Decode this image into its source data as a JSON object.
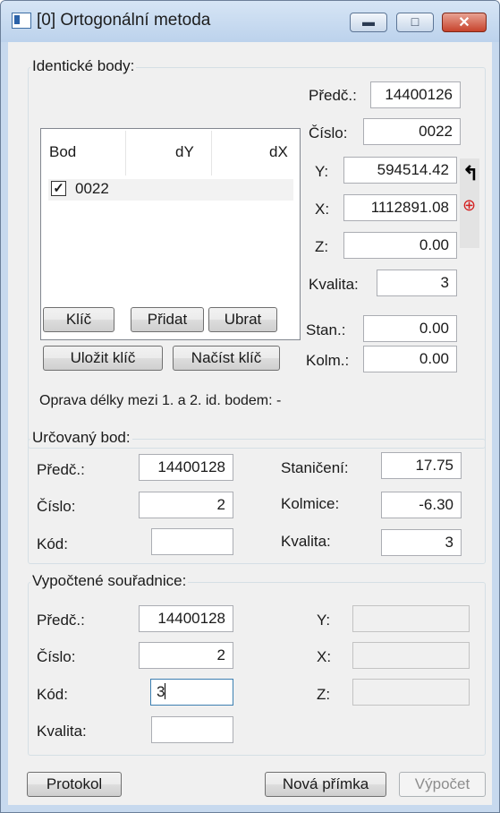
{
  "window": {
    "title": "[0] Ortogonální metoda"
  },
  "identical": {
    "group_title": "Identické body:",
    "columns": [
      "Bod",
      "dY",
      "dX"
    ],
    "rows": [
      {
        "checked": true,
        "bod": "0022"
      }
    ],
    "predc_label": "Předč.:",
    "predc_value": "14400126",
    "cislo_label": "Číslo:",
    "cislo_value": "0022",
    "y_label": "Y:",
    "y_value": "594514.42",
    "x_label": "X:",
    "x_value": "1112891.08",
    "z_label": "Z:",
    "z_value": "0.00",
    "kvalita_label": "Kvalita:",
    "kvalita_value": "3",
    "stan_label": "Stan.:",
    "stan_value": "0.00",
    "kolm_label": "Kolm.:",
    "kolm_value": "0.00",
    "buttons": {
      "klic": "Klíč",
      "pridat": "Přidat",
      "ubrat": "Ubrat",
      "ulozit": "Uložit klíč",
      "nacist": "Načíst klíč"
    },
    "note": "Oprava délky mezi 1. a 2. id. bodem:  -"
  },
  "urcovany": {
    "group_title": "Určovaný bod:",
    "predc_label": "Předč.:",
    "predc_value": "14400128",
    "cislo_label": "Číslo:",
    "cislo_value": "2",
    "kod_label": "Kód:",
    "kod_value": "",
    "stanicini_label": "Staničení:",
    "stanicini_value": "17.75",
    "kolmice_label": "Kolmice:",
    "kolmice_value": "-6.30",
    "kvalita_label": "Kvalita:",
    "kvalita_value": "3"
  },
  "vypoctene": {
    "group_title": "Vypočtené souřadnice:",
    "predc_label": "Předč.:",
    "predc_value": "14400128",
    "cislo_label": "Číslo:",
    "cislo_value": "2",
    "kod_label": "Kód:",
    "kod_value": "3",
    "kvalita_label": "Kvalita:",
    "kvalita_value": "",
    "y_label": "Y:",
    "y_value": "",
    "x_label": "X:",
    "x_value": "",
    "z_label": "Z:",
    "z_value": ""
  },
  "footer": {
    "protokol": "Protokol",
    "nova_primka": "Nová přímka",
    "vypocet": "Výpočet"
  }
}
